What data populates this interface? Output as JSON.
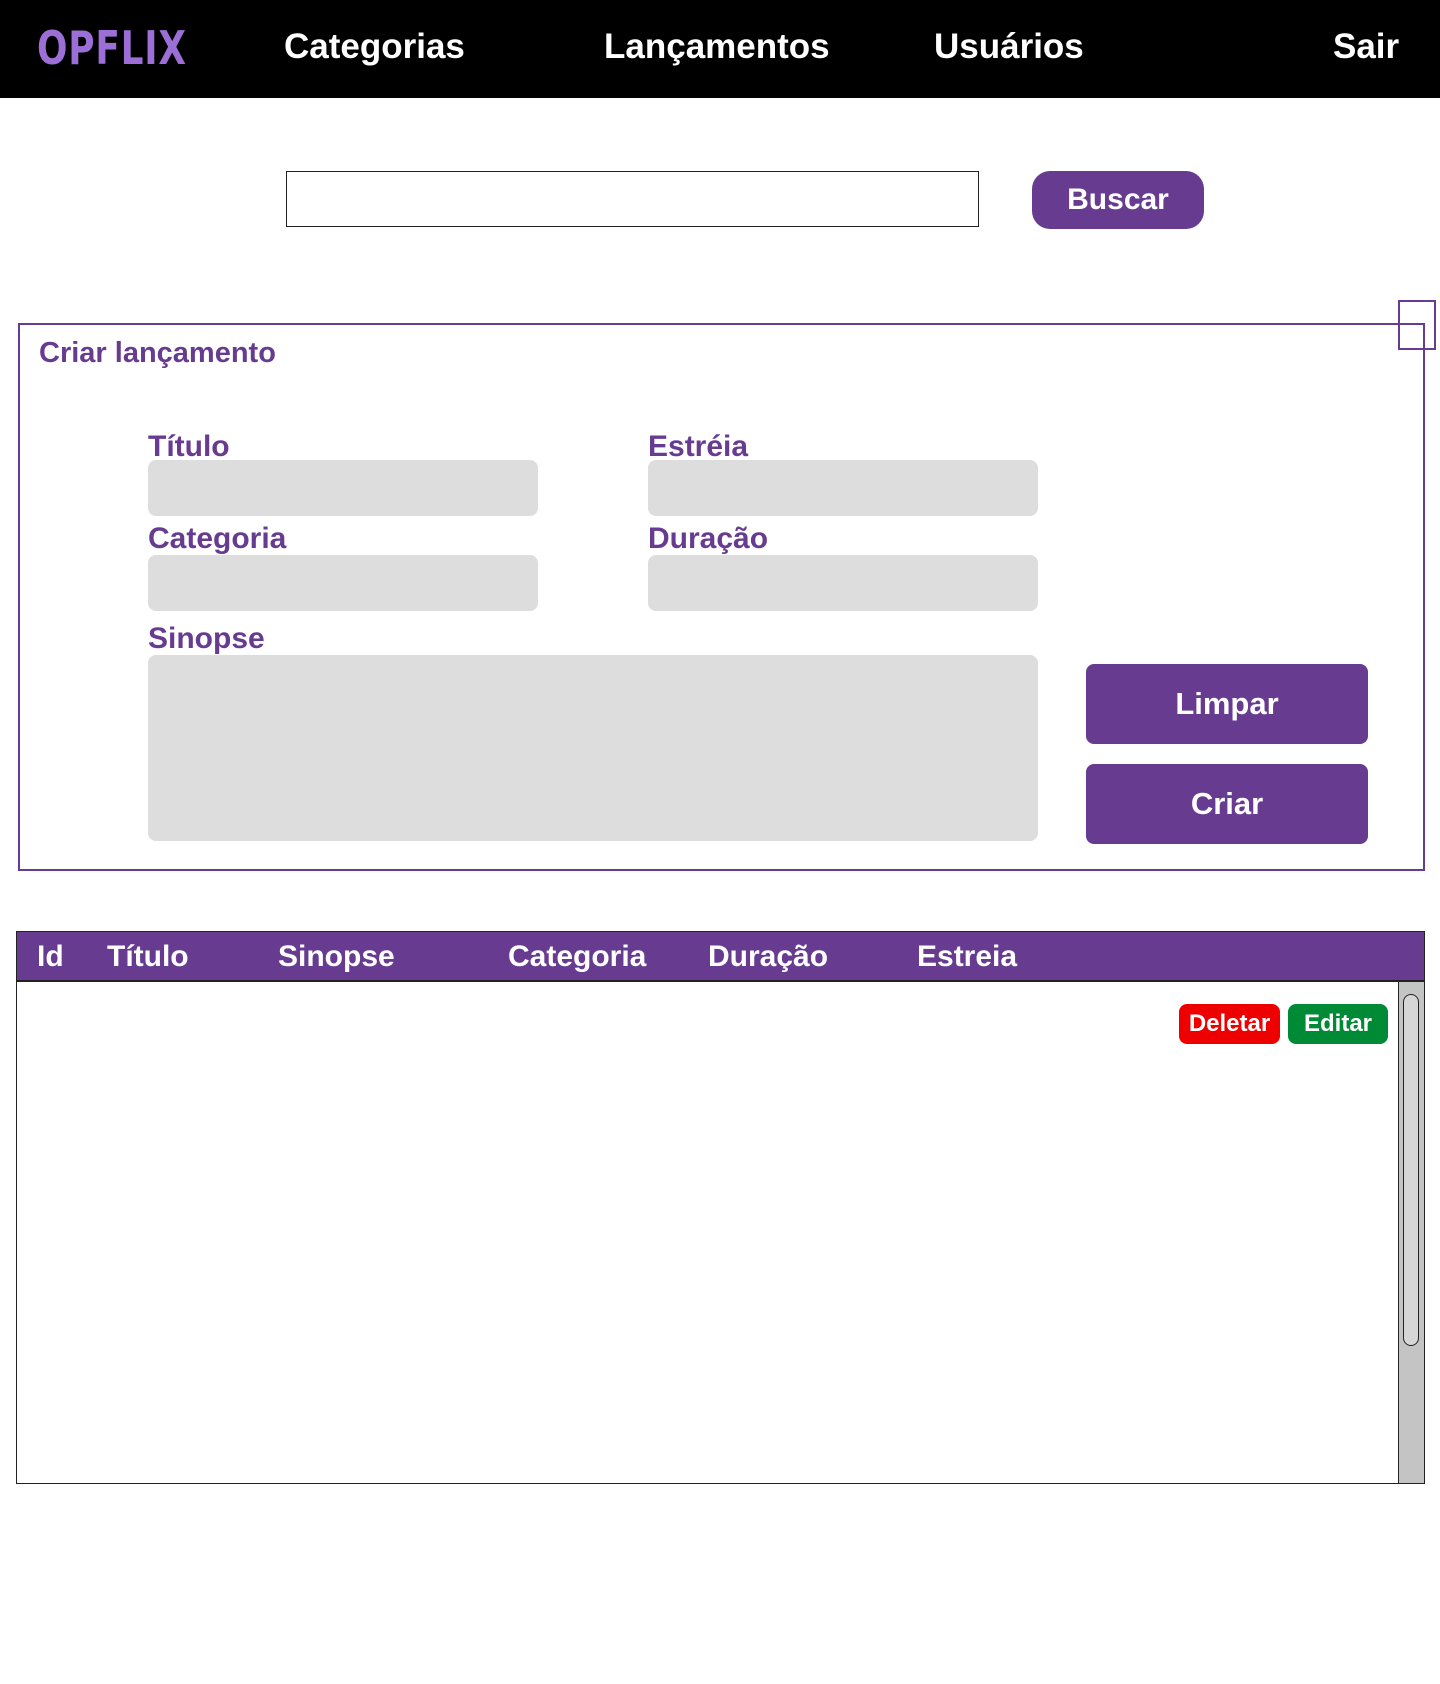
{
  "header": {
    "logo": "OPFLIX",
    "nav": {
      "categorias": "Categorias",
      "lancamentos": "Lançamentos",
      "usuarios": "Usuários",
      "sair": "Sair"
    }
  },
  "search": {
    "value": "",
    "button_label": "Buscar"
  },
  "form": {
    "title": "Criar lançamento",
    "fields": {
      "titulo": {
        "label": "Título",
        "value": ""
      },
      "estreia": {
        "label": "Estréia",
        "value": ""
      },
      "categoria": {
        "label": "Categoria",
        "value": ""
      },
      "duracao": {
        "label": "Duração",
        "value": ""
      },
      "sinopse": {
        "label": "Sinopse",
        "value": ""
      }
    },
    "buttons": {
      "limpar": "Limpar",
      "criar": "Criar"
    }
  },
  "table": {
    "columns": [
      "Id",
      "Título",
      "Sinopse",
      "Categoria",
      "Duração",
      "Estreia"
    ],
    "row_actions": {
      "deletar": "Deletar",
      "editar": "Editar"
    },
    "rows": []
  },
  "colors": {
    "primary": "#673c90",
    "logo": "#9b6fd6",
    "header_bg": "#000000",
    "input_bg": "#dddddd",
    "danger": "#ee0000",
    "success": "#008a36"
  }
}
